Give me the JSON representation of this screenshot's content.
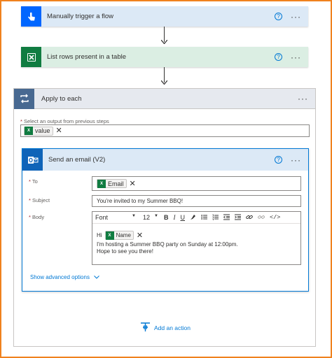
{
  "steps": {
    "trigger": {
      "title": "Manually trigger a flow",
      "help": "?",
      "more": "···"
    },
    "list_rows": {
      "title": "List rows present in a table",
      "help": "?",
      "more": "···"
    }
  },
  "apply_each": {
    "title": "Apply to each",
    "more": "···",
    "select_label_req": "*",
    "select_label": " Select an output from previous steps",
    "token": {
      "icon_text": "X",
      "label": "value"
    }
  },
  "send_email": {
    "title": "Send an email (V2)",
    "help": "?",
    "more": "···",
    "to": {
      "label_req": "*",
      "label": " To",
      "token_icon_text": "X",
      "token_label": "Email"
    },
    "subject": {
      "label_req": "*",
      "label": " Subject",
      "value": "You're invited to my Summer BBQ!"
    },
    "body": {
      "label_req": "*",
      "label": " Body",
      "toolbar": {
        "font": "Font",
        "size": "12",
        "caret": "▼"
      },
      "hi": "Hi",
      "name_token": {
        "icon_text": "X",
        "label": "Name"
      },
      "line1": "I'm hosting a Summer BBQ party on Sunday at 12:00pm.",
      "line2": "Hope to see you there!"
    },
    "show_advanced": "Show advanced options"
  },
  "add_action": {
    "label": "Add an action"
  },
  "colors": {
    "trigger_tile": "#0066ff",
    "excel_tile": "#107c41",
    "apply_tile": "#486991",
    "outlook_tile": "#0f64b8",
    "accent": "#0078d4",
    "frame": "#f0821e"
  }
}
